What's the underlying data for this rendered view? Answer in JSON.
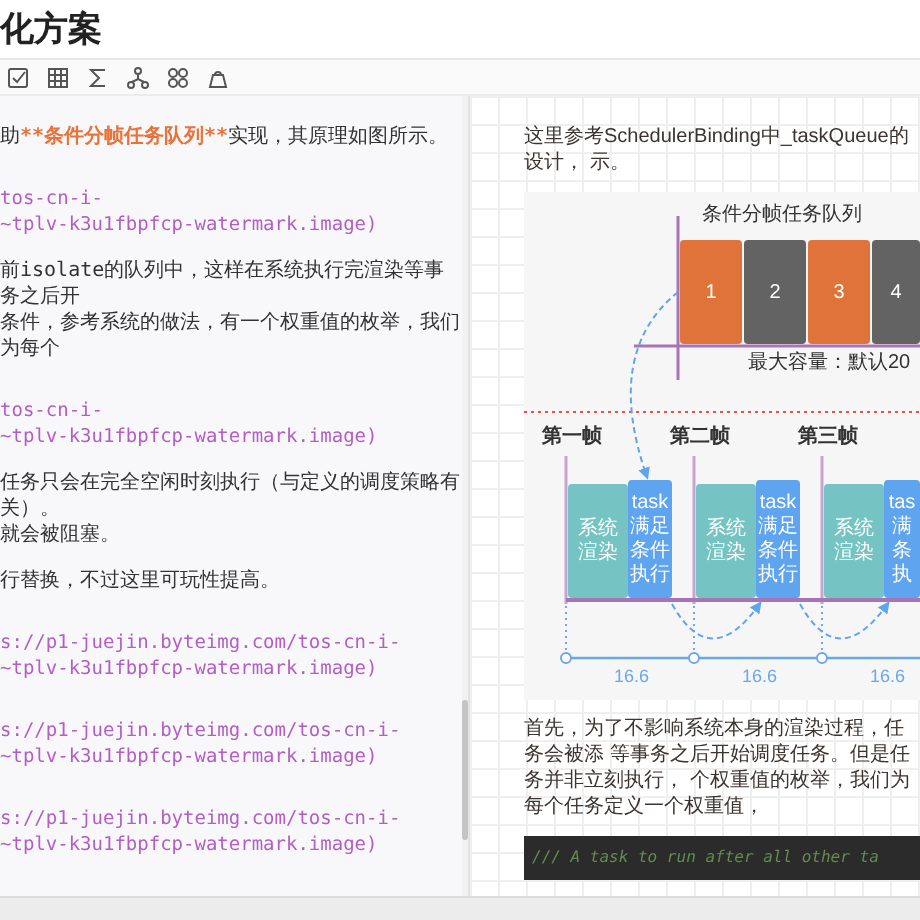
{
  "window": {
    "title": "化方案"
  },
  "editor": {
    "blocks": [
      {
        "kind": "text",
        "lines": [
          [
            {
              "kind": "plain",
              "text": "助"
            },
            {
              "kind": "strong",
              "text": "**条件分帧任务队列**"
            },
            {
              "kind": "plain",
              "text": "实现，其原理如图所示。"
            }
          ]
        ]
      },
      {
        "kind": "link",
        "lines": [
          [
            {
              "kind": "plain",
              "text": "tos-cn-i-"
            }
          ],
          [
            {
              "kind": "plain",
              "text": "~tplv-k3u1fbpfcp-watermark.image)"
            }
          ]
        ]
      },
      {
        "kind": "text",
        "lines": [
          [
            {
              "kind": "plain",
              "text": "前isolate的队列中，这样在系统执行完渲染等事务之后开"
            }
          ],
          [
            {
              "kind": "plain",
              "text": "条件，参考系统的做法，有一个权重值的枚举，我们为每个"
            }
          ]
        ]
      },
      {
        "kind": "link",
        "lines": [
          [
            {
              "kind": "plain",
              "text": "tos-cn-i-"
            }
          ],
          [
            {
              "kind": "plain",
              "text": "~tplv-k3u1fbpfcp-watermark.image)"
            }
          ]
        ]
      },
      {
        "kind": "text",
        "lines": [
          [
            {
              "kind": "plain",
              "text": "任务只会在完全空闲时刻执行（与定义的调度策略有关）。"
            }
          ],
          [
            {
              "kind": "plain",
              "text": "就会被阻塞。"
            }
          ]
        ]
      },
      {
        "kind": "text",
        "lines": [
          [
            {
              "kind": "plain",
              "text": "行替换，不过这里可玩性提高。"
            }
          ]
        ]
      },
      {
        "kind": "link",
        "lines": [
          [
            {
              "kind": "plain",
              "text": "s://p1-juejin.byteimg.com/tos-cn-i-"
            }
          ],
          [
            {
              "kind": "plain",
              "text": "~tplv-k3u1fbpfcp-watermark.image)"
            }
          ]
        ]
      },
      {
        "kind": "link",
        "lines": [
          [
            {
              "kind": "plain",
              "text": "s://p1-juejin.byteimg.com/tos-cn-i-"
            }
          ],
          [
            {
              "kind": "plain",
              "text": "~tplv-k3u1fbpfcp-watermark.image)"
            }
          ]
        ]
      },
      {
        "kind": "link",
        "lines": [
          [
            {
              "kind": "plain",
              "text": "s://p1-juejin.byteimg.com/tos-cn-i-"
            }
          ],
          [
            {
              "kind": "plain",
              "text": "~tplv-k3u1fbpfcp-watermark.image)"
            }
          ]
        ]
      }
    ]
  },
  "preview": {
    "items": [
      {
        "kind": "paragraph",
        "lines": [
          "这里参考SchedulerBinding中_taskQueue的设计，",
          "示。"
        ]
      },
      {
        "kind": "diagram",
        "title": "条件分帧任务队列",
        "capacity": "最大容量：默认20",
        "queue": [
          {
            "label": "1",
            "color": "#e07339"
          },
          {
            "label": "2",
            "color": "#636363"
          },
          {
            "label": "3",
            "color": "#e07339"
          },
          {
            "label": "4",
            "color": "#636363"
          }
        ],
        "frames": [
          {
            "label": "第一帧",
            "render": "系统渲染",
            "task": [
              "task",
              "满足",
              "条件",
              "执行"
            ],
            "interval": "16.6"
          },
          {
            "label": "第二帧",
            "render": "系统渲染",
            "task": [
              "task",
              "满足",
              "条件",
              "执行"
            ],
            "interval": "16.6"
          },
          {
            "label": "第三帧",
            "render": "系统渲染",
            "task": [
              "tas",
              "满",
              "条",
              "执"
            ],
            "interval": "16.6"
          }
        ]
      },
      {
        "kind": "paragraph",
        "lines": [
          "首先，为了不影响系统本身的渲染过程，任务会被添",
          "等事务之后开始调度任务。但是任务并非立刻执行，",
          "个权重值的枚举，我们为每个任务定义一个权重值，"
        ]
      },
      {
        "kind": "code",
        "text": "/// A task to run after all other ta"
      }
    ]
  }
}
